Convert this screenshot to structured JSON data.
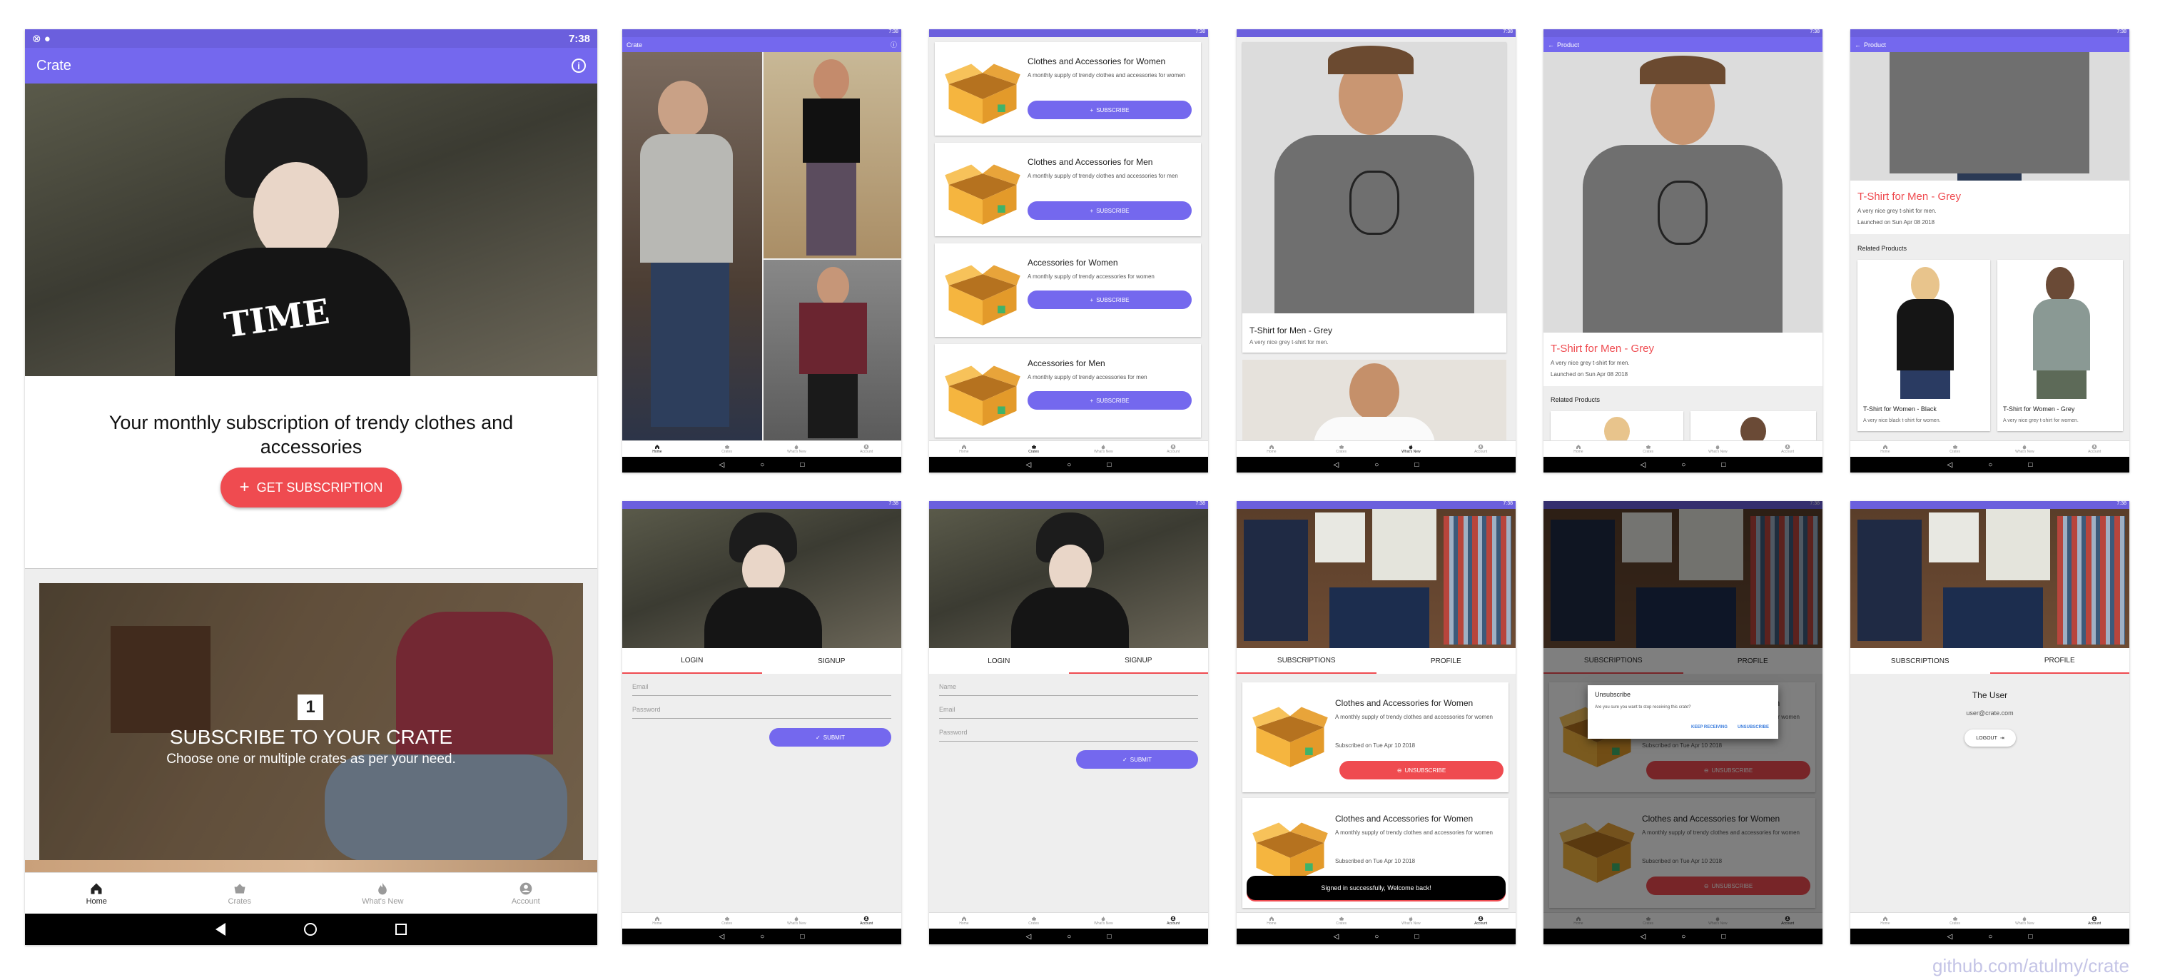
{
  "time": "7:38",
  "app_title": "Crate",
  "product_title": "Product",
  "home": {
    "headline": "Your monthly subscription of trendy clothes and accessories",
    "cta": "GET SUBSCRIPTION",
    "step_number": "1",
    "step_title": "SUBSCRIBE TO YOUR CRATE",
    "step_text": "Choose one or multiple crates as per your need."
  },
  "bottom_nav": [
    "Home",
    "Crates",
    "What's New",
    "Account"
  ],
  "crates": [
    {
      "title": "Clothes and Accessories for Women",
      "desc": "A monthly supply of trendy clothes and accessories for women"
    },
    {
      "title": "Clothes and Accessories for Men",
      "desc": "A monthly supply of trendy clothes and accessories for men"
    },
    {
      "title": "Accessories for Women",
      "desc": "A monthly supply of trendy accessories for women"
    },
    {
      "title": "Accessories for Men",
      "desc": "A monthly supply of trendy accessories for men"
    }
  ],
  "subscribe_label": "SUBSCRIBE",
  "product": {
    "name": "T-Shirt for Men - Grey",
    "desc": "A very nice grey t-shirt for men.",
    "launched": "Launched on Sun Apr 08 2018",
    "related_heading": "Related Products",
    "related": [
      {
        "name": "T-Shirt for Women - Black",
        "desc": "A very nice black t-shirt for women."
      },
      {
        "name": "T-Shirt for Women - Grey",
        "desc": "A very nice grey t-shirt for women."
      }
    ]
  },
  "auth": {
    "login_tab": "LOGIN",
    "signup_tab": "SIGNUP",
    "name_placeholder": "Name",
    "email_placeholder": "Email",
    "password_placeholder": "Password",
    "submit": "SUBMIT"
  },
  "account": {
    "subs_tab": "SUBSCRIPTIONS",
    "profile_tab": "PROFILE",
    "subscribed_on": "Subscribed on Tue Apr 10 2018",
    "unsubscribe": "UNSUBSCRIBE",
    "toast": "Signed in successfully, Welcome back!",
    "dialog_title": "Unsubscribe",
    "dialog_text": "Are you sure you want to stop receiving this crate?",
    "keep_receiving": "KEEP RECEIVING",
    "dialog_unsubscribe": "UNSUBSCRIBE",
    "user_name": "The User",
    "user_email": "user@crate.com",
    "logout": "LOGOUT"
  },
  "credit": "github.com/atulmy/crate",
  "colors": {
    "primary": "#7468ee",
    "accent": "#ef4b50",
    "status": "#6b5fdd"
  }
}
